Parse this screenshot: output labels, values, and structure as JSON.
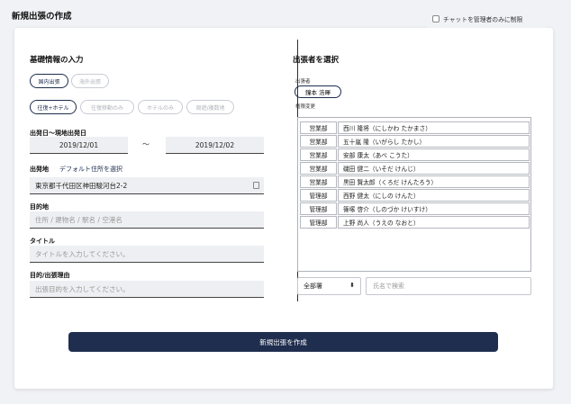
{
  "page": {
    "title": "新規出張の作成"
  },
  "left": {
    "section_title": "基礎情報の入力",
    "trip_type": [
      "国内出張",
      "海外出張"
    ],
    "travel_mode": [
      "往復+ホテル",
      "往復移動のみ",
      "ホテルのみ",
      "周遊/複数地"
    ],
    "dates": {
      "label": "出発日〜現地出発日",
      "start": "2019/12/01",
      "separator": "〜",
      "end": "2019/12/02"
    },
    "departure": {
      "label": "出発地",
      "link": "デフォルト住所を選択",
      "value": "東京都千代田区神田駿河台2-2"
    },
    "destination": {
      "label": "目的地",
      "placeholder": "住所 / 建物名 / 駅名 / 空港名"
    },
    "title_field": {
      "label": "タイトル",
      "placeholder": "タイトルを入力してください。"
    },
    "purpose": {
      "label": "目的/出張理由",
      "placeholder": "出張目的を入力してください。"
    }
  },
  "right": {
    "chat_restrict_label": "チャットを管理者のみに制限",
    "section_title": "出張者を選択",
    "traveler_label": "出張者",
    "traveler_name": "鐘本 浩暉",
    "permission_change": "権限変更",
    "people": [
      {
        "dept": "営業部",
        "name": "西川 隆将（にしかわ たかまさ）"
      },
      {
        "dept": "営業部",
        "name": "五十嵐 隆（いがらし たかし）"
      },
      {
        "dept": "営業部",
        "name": "安部 康太（あべ こうた）"
      },
      {
        "dept": "営業部",
        "name": "磯田 健二（いそだ けんじ）"
      },
      {
        "dept": "営業部",
        "name": "黒田 賢太郎（くろだ けんたろう）"
      },
      {
        "dept": "管理部",
        "name": "西野 健太（にしの けんた）"
      },
      {
        "dept": "管理部",
        "name": "篠塚 啓介（しのづか けいすけ）"
      },
      {
        "dept": "管理部",
        "name": "上野 尚人（うえの なおと）"
      }
    ],
    "dept_filter": "全部署",
    "name_search_placeholder": "氏名で検索"
  },
  "submit_label": "新規出張を作成"
}
